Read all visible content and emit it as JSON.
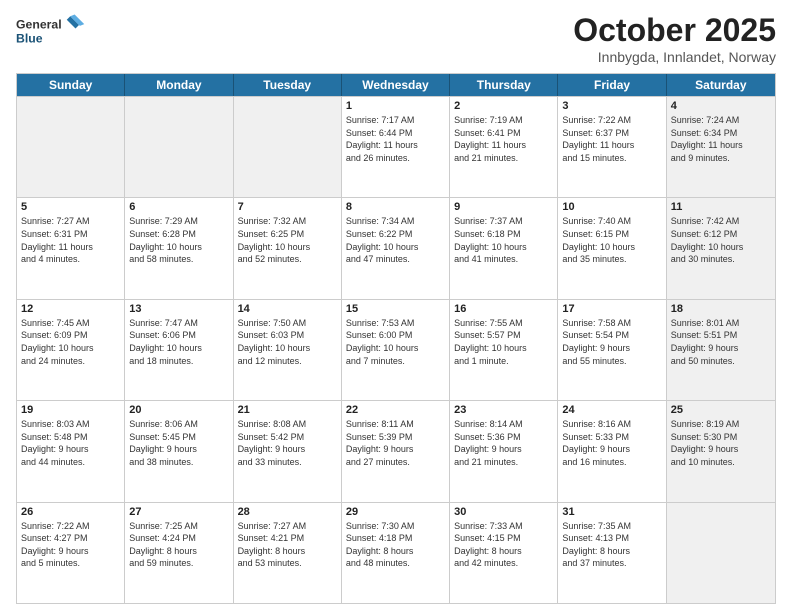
{
  "header": {
    "logo_general": "General",
    "logo_blue": "Blue",
    "title": "October 2025",
    "subtitle": "Innbygda, Innlandet, Norway"
  },
  "days": [
    "Sunday",
    "Monday",
    "Tuesday",
    "Wednesday",
    "Thursday",
    "Friday",
    "Saturday"
  ],
  "rows": [
    [
      {
        "day": "",
        "text": "",
        "shaded": true
      },
      {
        "day": "",
        "text": "",
        "shaded": true
      },
      {
        "day": "",
        "text": "",
        "shaded": true
      },
      {
        "day": "1",
        "text": "Sunrise: 7:17 AM\nSunset: 6:44 PM\nDaylight: 11 hours\nand 26 minutes."
      },
      {
        "day": "2",
        "text": "Sunrise: 7:19 AM\nSunset: 6:41 PM\nDaylight: 11 hours\nand 21 minutes."
      },
      {
        "day": "3",
        "text": "Sunrise: 7:22 AM\nSunset: 6:37 PM\nDaylight: 11 hours\nand 15 minutes."
      },
      {
        "day": "4",
        "text": "Sunrise: 7:24 AM\nSunset: 6:34 PM\nDaylight: 11 hours\nand 9 minutes.",
        "shaded": true
      }
    ],
    [
      {
        "day": "5",
        "text": "Sunrise: 7:27 AM\nSunset: 6:31 PM\nDaylight: 11 hours\nand 4 minutes."
      },
      {
        "day": "6",
        "text": "Sunrise: 7:29 AM\nSunset: 6:28 PM\nDaylight: 10 hours\nand 58 minutes."
      },
      {
        "day": "7",
        "text": "Sunrise: 7:32 AM\nSunset: 6:25 PM\nDaylight: 10 hours\nand 52 minutes."
      },
      {
        "day": "8",
        "text": "Sunrise: 7:34 AM\nSunset: 6:22 PM\nDaylight: 10 hours\nand 47 minutes."
      },
      {
        "day": "9",
        "text": "Sunrise: 7:37 AM\nSunset: 6:18 PM\nDaylight: 10 hours\nand 41 minutes."
      },
      {
        "day": "10",
        "text": "Sunrise: 7:40 AM\nSunset: 6:15 PM\nDaylight: 10 hours\nand 35 minutes."
      },
      {
        "day": "11",
        "text": "Sunrise: 7:42 AM\nSunset: 6:12 PM\nDaylight: 10 hours\nand 30 minutes.",
        "shaded": true
      }
    ],
    [
      {
        "day": "12",
        "text": "Sunrise: 7:45 AM\nSunset: 6:09 PM\nDaylight: 10 hours\nand 24 minutes."
      },
      {
        "day": "13",
        "text": "Sunrise: 7:47 AM\nSunset: 6:06 PM\nDaylight: 10 hours\nand 18 minutes."
      },
      {
        "day": "14",
        "text": "Sunrise: 7:50 AM\nSunset: 6:03 PM\nDaylight: 10 hours\nand 12 minutes."
      },
      {
        "day": "15",
        "text": "Sunrise: 7:53 AM\nSunset: 6:00 PM\nDaylight: 10 hours\nand 7 minutes."
      },
      {
        "day": "16",
        "text": "Sunrise: 7:55 AM\nSunset: 5:57 PM\nDaylight: 10 hours\nand 1 minute."
      },
      {
        "day": "17",
        "text": "Sunrise: 7:58 AM\nSunset: 5:54 PM\nDaylight: 9 hours\nand 55 minutes."
      },
      {
        "day": "18",
        "text": "Sunrise: 8:01 AM\nSunset: 5:51 PM\nDaylight: 9 hours\nand 50 minutes.",
        "shaded": true
      }
    ],
    [
      {
        "day": "19",
        "text": "Sunrise: 8:03 AM\nSunset: 5:48 PM\nDaylight: 9 hours\nand 44 minutes."
      },
      {
        "day": "20",
        "text": "Sunrise: 8:06 AM\nSunset: 5:45 PM\nDaylight: 9 hours\nand 38 minutes."
      },
      {
        "day": "21",
        "text": "Sunrise: 8:08 AM\nSunset: 5:42 PM\nDaylight: 9 hours\nand 33 minutes."
      },
      {
        "day": "22",
        "text": "Sunrise: 8:11 AM\nSunset: 5:39 PM\nDaylight: 9 hours\nand 27 minutes."
      },
      {
        "day": "23",
        "text": "Sunrise: 8:14 AM\nSunset: 5:36 PM\nDaylight: 9 hours\nand 21 minutes."
      },
      {
        "day": "24",
        "text": "Sunrise: 8:16 AM\nSunset: 5:33 PM\nDaylight: 9 hours\nand 16 minutes."
      },
      {
        "day": "25",
        "text": "Sunrise: 8:19 AM\nSunset: 5:30 PM\nDaylight: 9 hours\nand 10 minutes.",
        "shaded": true
      }
    ],
    [
      {
        "day": "26",
        "text": "Sunrise: 7:22 AM\nSunset: 4:27 PM\nDaylight: 9 hours\nand 5 minutes."
      },
      {
        "day": "27",
        "text": "Sunrise: 7:25 AM\nSunset: 4:24 PM\nDaylight: 8 hours\nand 59 minutes."
      },
      {
        "day": "28",
        "text": "Sunrise: 7:27 AM\nSunset: 4:21 PM\nDaylight: 8 hours\nand 53 minutes."
      },
      {
        "day": "29",
        "text": "Sunrise: 7:30 AM\nSunset: 4:18 PM\nDaylight: 8 hours\nand 48 minutes."
      },
      {
        "day": "30",
        "text": "Sunrise: 7:33 AM\nSunset: 4:15 PM\nDaylight: 8 hours\nand 42 minutes."
      },
      {
        "day": "31",
        "text": "Sunrise: 7:35 AM\nSunset: 4:13 PM\nDaylight: 8 hours\nand 37 minutes."
      },
      {
        "day": "",
        "text": "",
        "shaded": true
      }
    ]
  ]
}
